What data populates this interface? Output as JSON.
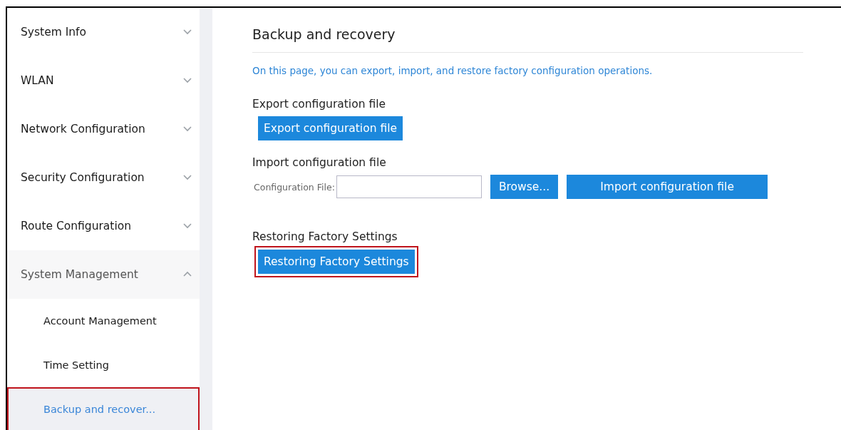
{
  "sidebar": {
    "items": [
      {
        "label": "System Info",
        "expanded": false
      },
      {
        "label": "WLAN",
        "expanded": false
      },
      {
        "label": "Network Configuration",
        "expanded": false
      },
      {
        "label": "Security Configuration",
        "expanded": false
      },
      {
        "label": "Route Configuration",
        "expanded": false
      },
      {
        "label": "System Management",
        "expanded": true,
        "children": [
          {
            "label": "Account Management",
            "selected": false,
            "highlighted": false
          },
          {
            "label": "Time Setting",
            "selected": false,
            "highlighted": false
          },
          {
            "label": "Backup and recover...",
            "selected": true,
            "highlighted": true
          }
        ]
      }
    ]
  },
  "page": {
    "title": "Backup and recovery",
    "description": "On this page, you can export, import, and restore factory configuration operations.",
    "sections": [
      {
        "kind": "export",
        "heading": "Export configuration file",
        "button": {
          "label": "Export configuration file"
        }
      },
      {
        "kind": "import",
        "heading": "Import configuration file",
        "field_label": "Configuration File:",
        "browse": "Browse...",
        "button": {
          "label": "Import configuration file"
        }
      },
      {
        "kind": "restore",
        "heading": "Restoring Factory Settings",
        "button": {
          "label": "Restoring Factory Settings",
          "highlighted": true
        }
      }
    ]
  }
}
